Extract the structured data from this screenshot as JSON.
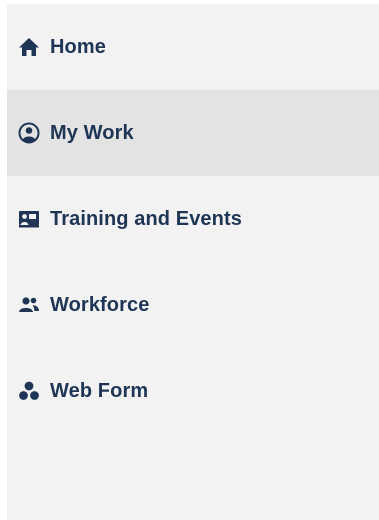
{
  "nav": {
    "items": [
      {
        "label": "Home",
        "icon": "home-icon",
        "active": false
      },
      {
        "label": "My Work",
        "icon": "user-circle-icon",
        "active": true
      },
      {
        "label": "Training and Events",
        "icon": "presentation-icon",
        "active": false
      },
      {
        "label": "Workforce",
        "icon": "users-icon",
        "active": false
      },
      {
        "label": "Web Form",
        "icon": "cubes-icon",
        "active": false
      }
    ]
  },
  "colors": {
    "sidebar_bg": "#f2f2f2",
    "active_bg": "#e3e3e3",
    "text": "#1e3556"
  }
}
